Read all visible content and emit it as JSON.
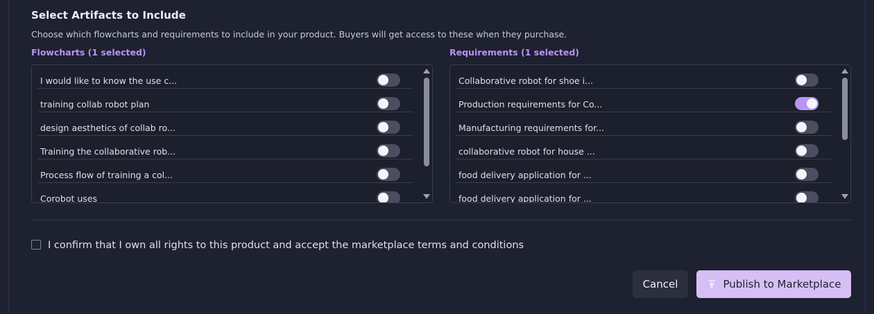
{
  "section": {
    "title": "Select Artifacts to Include",
    "description": "Choose which flowcharts and requirements to include in your product. Buyers will get access to these when they purchase."
  },
  "flowcharts": {
    "label": "Flowcharts (1 selected)",
    "items": [
      {
        "label": "I would like to know the use c...",
        "enabled": false
      },
      {
        "label": "training collab robot plan",
        "enabled": false
      },
      {
        "label": "design aesthetics of collab ro...",
        "enabled": false
      },
      {
        "label": "Training the collaborative rob...",
        "enabled": false
      },
      {
        "label": "Process flow of training a col...",
        "enabled": false
      },
      {
        "label": "Corobot uses",
        "enabled": false
      }
    ]
  },
  "requirements": {
    "label": "Requirements (1 selected)",
    "items": [
      {
        "label": "Collaborative robot for shoe i...",
        "enabled": false
      },
      {
        "label": "Production requirements for Co...",
        "enabled": true
      },
      {
        "label": "Manufacturing requirements for...",
        "enabled": false
      },
      {
        "label": "collaborative robot for house ...",
        "enabled": false
      },
      {
        "label": "food delivery application for ...",
        "enabled": false
      },
      {
        "label": "food delivery application for ...",
        "enabled": false
      }
    ]
  },
  "confirm": {
    "label": "I confirm that I own all rights to this product and accept the marketplace terms and conditions",
    "checked": false
  },
  "actions": {
    "cancel_label": "Cancel",
    "publish_label": "Publish to Marketplace",
    "publish_icon": "upload-icon"
  },
  "colors": {
    "background": "#1e2130",
    "accent": "#b794f4",
    "publish_button": "#d6bff5"
  }
}
